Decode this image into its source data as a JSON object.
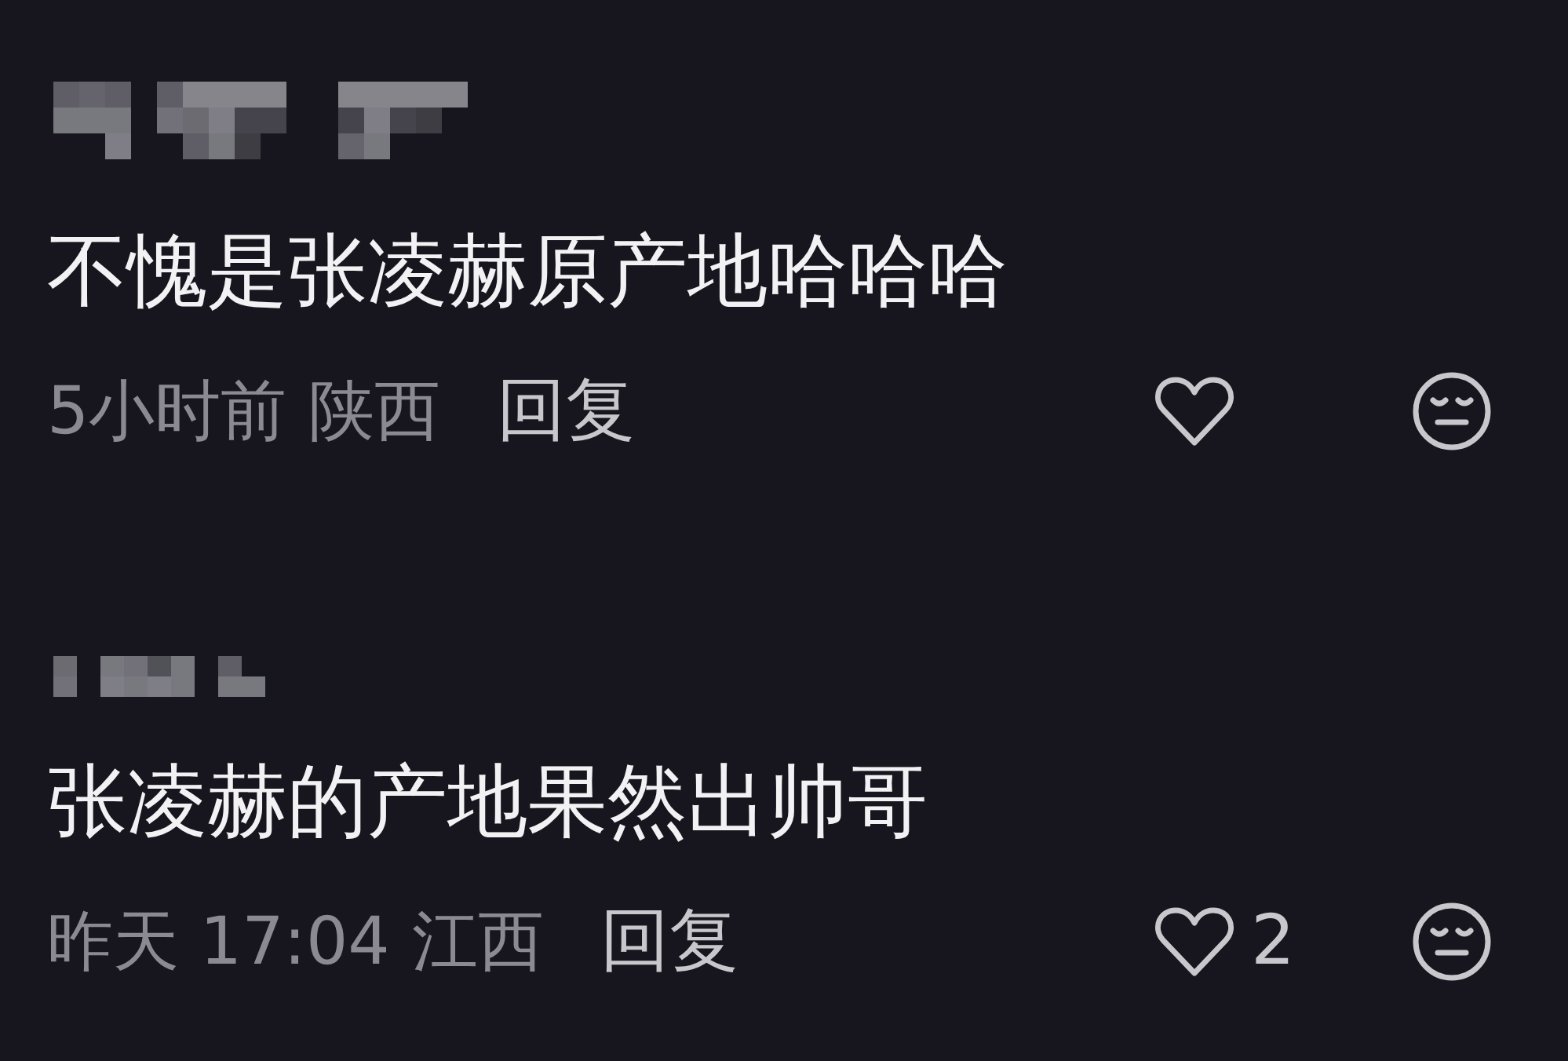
{
  "comments": [
    {
      "text": "不愧是张凌赫原产地哈哈哈",
      "time": "5小时前",
      "location": "陕西",
      "reply": "回复"
    },
    {
      "text": "张凌赫的产地果然出帅哥",
      "time": "昨天 17:04",
      "location": "江西",
      "reply": "回复",
      "like_count": "2"
    }
  ]
}
